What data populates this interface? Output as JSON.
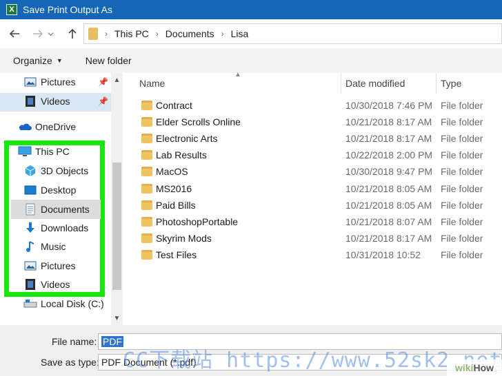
{
  "window": {
    "title": "Save Print Output As",
    "app_icon_letter": "X"
  },
  "address": {
    "crumbs": [
      "This PC",
      "Documents",
      "Lisa"
    ],
    "separator": "›"
  },
  "toolbar": {
    "organize_label": "Organize",
    "new_folder_label": "New folder"
  },
  "navpane": {
    "items": [
      {
        "label": "Pictures",
        "icon": "pictures-icon",
        "pinned": true
      },
      {
        "label": "Videos",
        "icon": "videos-icon",
        "pinned": true
      },
      {
        "label": "OneDrive",
        "icon": "onedrive-icon"
      },
      {
        "label": "This PC",
        "icon": "this-pc-icon"
      },
      {
        "label": "3D Objects",
        "icon": "3d-objects-icon"
      },
      {
        "label": "Desktop",
        "icon": "desktop-icon"
      },
      {
        "label": "Documents",
        "icon": "documents-icon",
        "selected": true
      },
      {
        "label": "Downloads",
        "icon": "downloads-icon"
      },
      {
        "label": "Music",
        "icon": "music-icon"
      },
      {
        "label": "Pictures",
        "icon": "pictures-icon"
      },
      {
        "label": "Videos",
        "icon": "videos-icon"
      },
      {
        "label": "Local Disk (C:)",
        "icon": "local-disk-icon"
      }
    ],
    "highlight_color": "#19e80f"
  },
  "columns": {
    "name": "Name",
    "date": "Date modified",
    "type": "Type"
  },
  "files": [
    {
      "name": "Contract",
      "date": "10/30/2018 7:46 PM",
      "type": "File folder"
    },
    {
      "name": "Elder Scrolls Online",
      "date": "10/21/2018 8:17 AM",
      "type": "File folder"
    },
    {
      "name": "Electronic Arts",
      "date": "10/21/2018 8:17 AM",
      "type": "File folder"
    },
    {
      "name": "Lab Results",
      "date": "10/22/2018 2:00 PM",
      "type": "File folder"
    },
    {
      "name": "MacOS",
      "date": "10/30/2018 9:47 PM",
      "type": "File folder"
    },
    {
      "name": "MS2016",
      "date": "10/21/2018 8:05 AM",
      "type": "File folder"
    },
    {
      "name": "Paid Bills",
      "date": "10/21/2018 8:05 AM",
      "type": "File folder"
    },
    {
      "name": "PhotoshopPortable",
      "date": "10/21/2018 8:07 AM",
      "type": "File folder"
    },
    {
      "name": "Skyrim Mods",
      "date": "10/21/2018 8:17 AM",
      "type": "File folder"
    },
    {
      "name": "Test Files",
      "date": "10/31/2018 10:52",
      "type": "File folder"
    }
  ],
  "form": {
    "filename_label": "File name:",
    "filename_value": "PDF",
    "savetype_label": "Save as type:",
    "savetype_value": "PDF Document (*.pdf)"
  },
  "overlay": {
    "watermark": "CC下载站 https://www.52sk2.net",
    "brand_wiki": "wiki",
    "brand_how": "How"
  },
  "colors": {
    "titlebar": "#1565b8",
    "folder": "#efc35f",
    "selection": "#2f74d0"
  }
}
